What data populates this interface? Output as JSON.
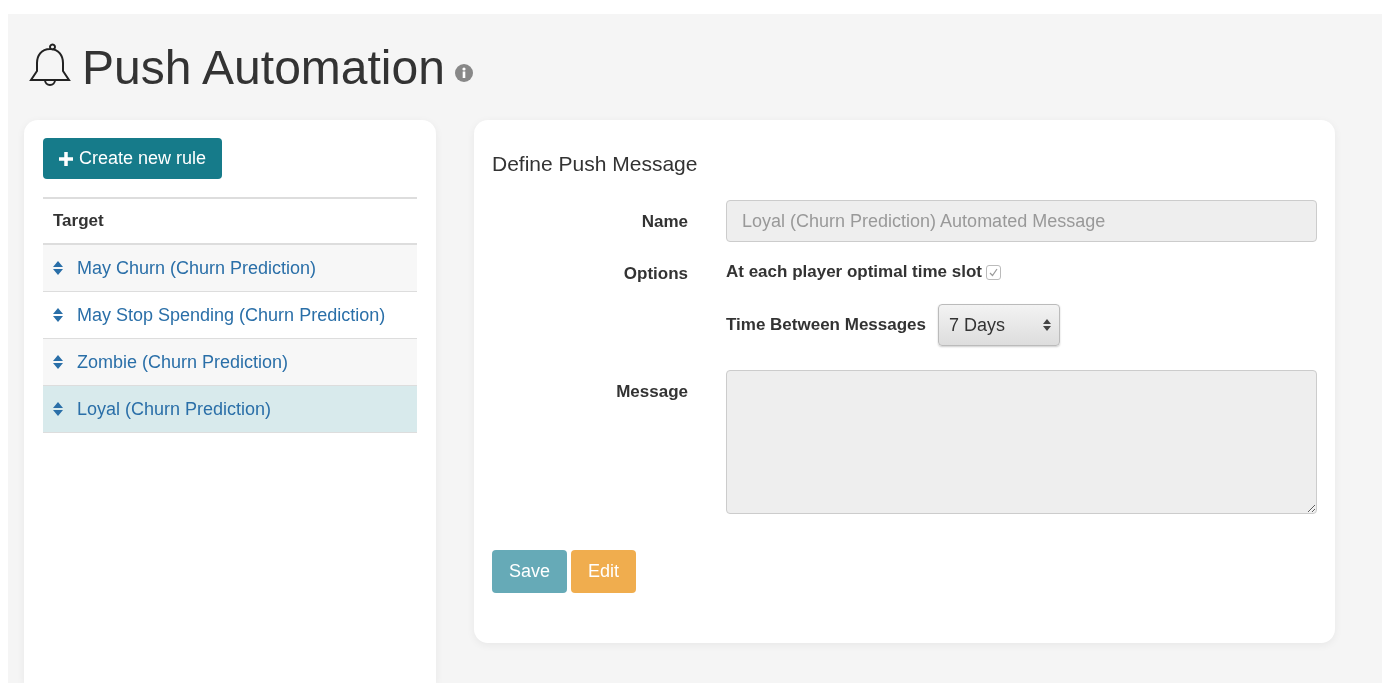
{
  "page": {
    "title": "Push Automation"
  },
  "rules": {
    "create_button": "Create new rule",
    "column": "Target",
    "items": [
      {
        "label": "May Churn (Churn Prediction)",
        "selected": false
      },
      {
        "label": "May Stop Spending (Churn Prediction)",
        "selected": false
      },
      {
        "label": "Zombie (Churn Prediction)",
        "selected": false
      },
      {
        "label": "Loyal (Churn Prediction)",
        "selected": true
      }
    ]
  },
  "form": {
    "title": "Define Push Message",
    "name": {
      "label": "Name",
      "placeholder": "Loyal (Churn Prediction) Automated Message",
      "disabled": true
    },
    "options": {
      "label": "Options",
      "checkbox_label": "At each player optimal time slot",
      "checked": true,
      "interval_label": "Time Between Messages",
      "interval_value": "7 Days"
    },
    "message": {
      "label": "Message",
      "disabled": true
    },
    "buttons": [
      {
        "label": "Save",
        "kind": "primary"
      },
      {
        "label": "Edit",
        "kind": "warning"
      }
    ]
  }
}
